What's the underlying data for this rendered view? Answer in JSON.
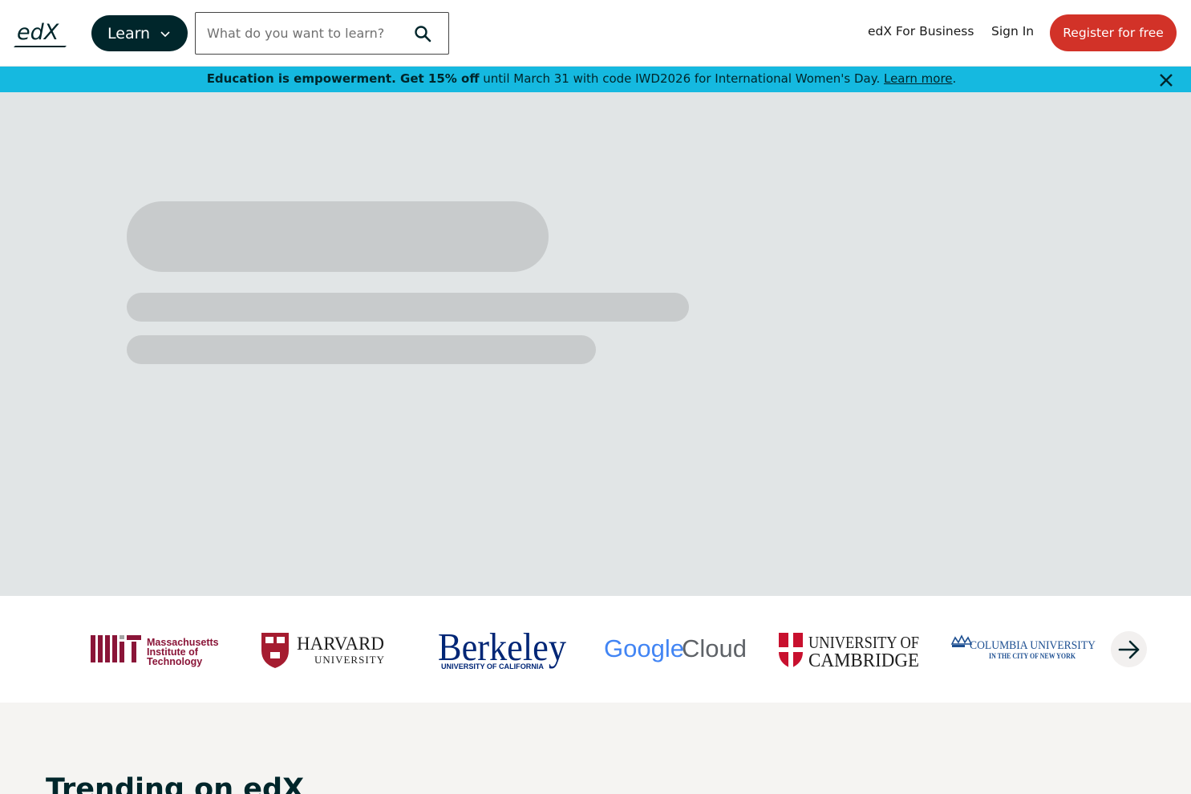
{
  "header": {
    "logo_text": "edX",
    "learn_label": "Learn",
    "search_placeholder": "What do you want to learn?",
    "business_label": "edX For Business",
    "signin_label": "Sign In",
    "register_label": "Register for free"
  },
  "promo": {
    "bold_text": "Education is empowerment. Get 15% off",
    "text": " until March 31 with code IWD2026 for International Women's Day. ",
    "link_text": "Learn more",
    "trail": "."
  },
  "partners": [
    {
      "name": "Massachusetts Institute of Technology",
      "line1": "Massachusetts",
      "line2": "Institute of",
      "line3": "Technology"
    },
    {
      "name": "Harvard University",
      "line1": "HARVARD",
      "line2": "UNIVERSITY"
    },
    {
      "name": "Berkeley",
      "line1": "Berkeley",
      "line2": "UNIVERSITY OF CALIFORNIA"
    },
    {
      "name": "Google Cloud",
      "line1": "Google",
      "line2": "Cloud"
    },
    {
      "name": "University of Cambridge",
      "line1": "UNIVERSITY OF",
      "line2": "CAMBRIDGE"
    },
    {
      "name": "Columbia University",
      "line1": "COLUMBIA UNIVERSITY",
      "line2": "IN THE CITY OF NEW YORK"
    }
  ],
  "trending": {
    "title": "Trending on edX"
  },
  "colors": {
    "brand_dark": "#00262b",
    "register_red": "#d23228",
    "promo_blue": "#15b9e0",
    "skeleton_bg": "#e1e5e6",
    "skeleton_bar": "#c8cbcc"
  }
}
